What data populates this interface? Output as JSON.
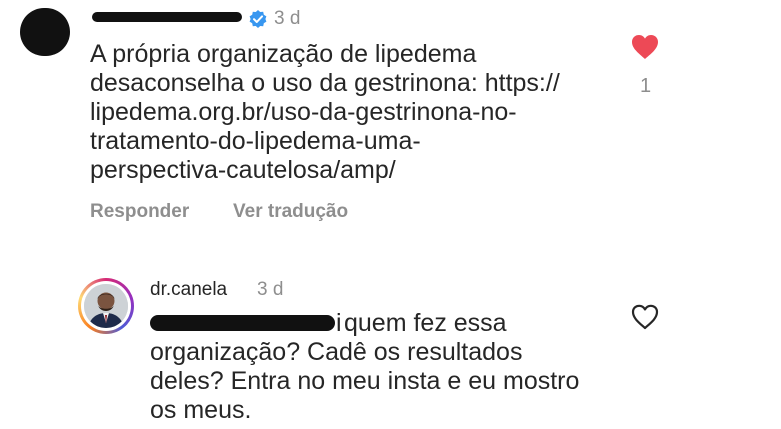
{
  "comment1": {
    "time": "3 d",
    "text": "A própria organização de lipedema\ndesaconselha o uso da gestrinona: https://\nlipedema.org.br/uso-da-gestrinona-no-\ntratamento-do-lipedema-uma-\nperspectiva-cautelosa/amp/",
    "like_count": "1",
    "liked": true,
    "actions": {
      "reply": "Responder",
      "translate": "Ver tradução"
    },
    "verified_icon": "verified-badge-icon",
    "heart_icon": "heart-filled-icon",
    "heart_color": "#ed4956",
    "verified_color": "#3897f0"
  },
  "comment2": {
    "username": "dr.canela",
    "time": "3 d",
    "mention_suffix": "i",
    "text_line1": " quem fez essa",
    "text_rest": "organização? Cadê os resultados\ndeles? Entra no meu insta e eu mostro\nos meus.",
    "liked": false,
    "heart_icon": "heart-outline-icon",
    "avatar_ring_colors": [
      "#feda75",
      "#fa7e1e",
      "#d62976",
      "#962fbf"
    ]
  }
}
